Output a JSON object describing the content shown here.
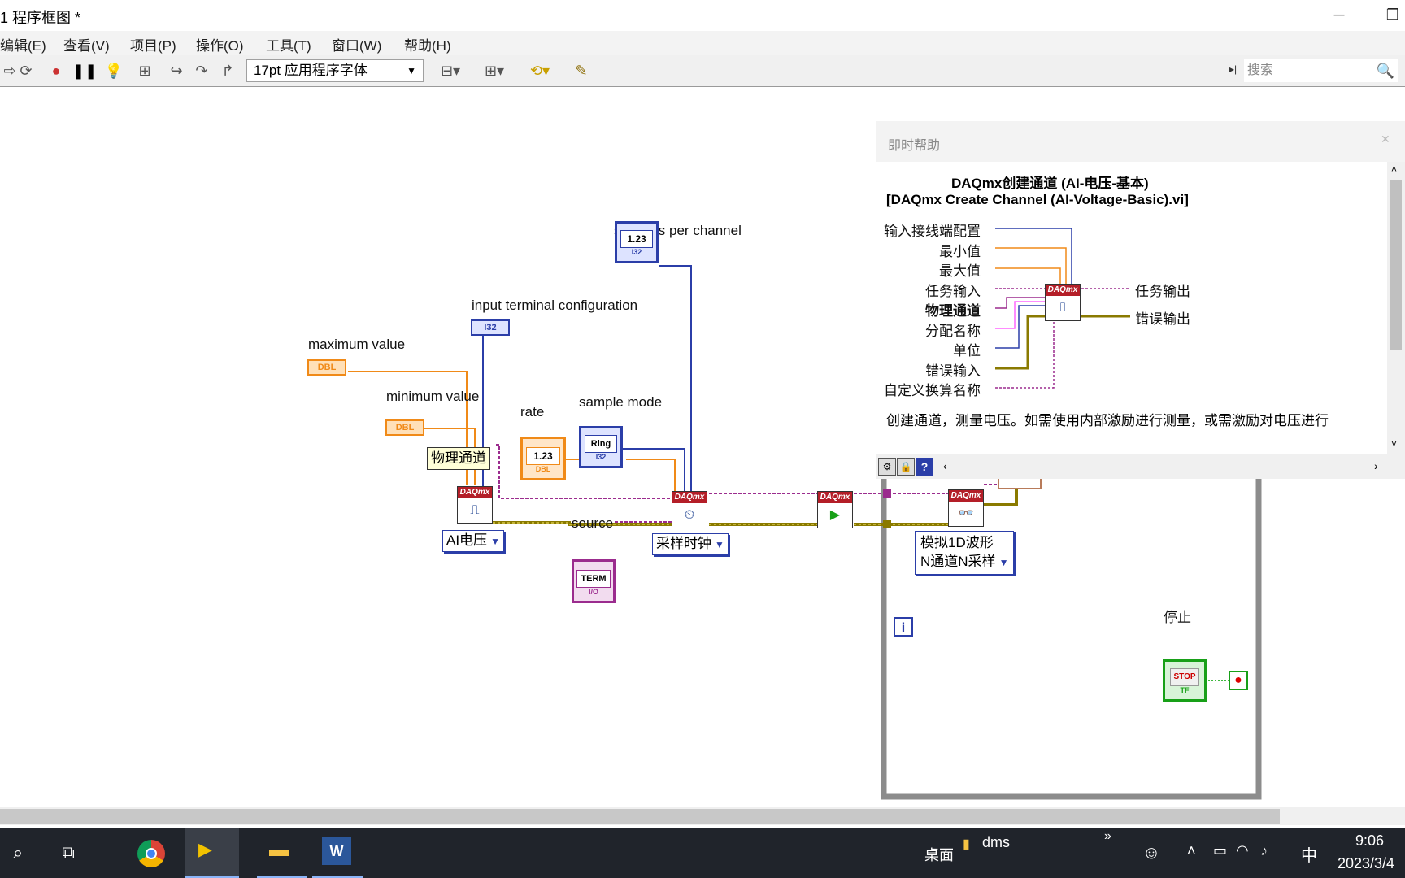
{
  "window": {
    "title": "1 程序框图 *",
    "minimize": "─",
    "restore": "❐"
  },
  "menu": [
    "编辑(E)",
    "查看(V)",
    "项目(P)",
    "操作(O)",
    "工具(T)",
    "窗口(W)",
    "帮助(H)"
  ],
  "toolbar": {
    "font": "17pt 应用程序字体",
    "search_placeholder": "搜索"
  },
  "diagram": {
    "labels": {
      "samples_per_channel": "samples per channel",
      "input_terminal_configuration": "input terminal configuration",
      "maximum_value": "maximum value",
      "minimum_value": "minimum value",
      "rate": "rate",
      "sample_mode": "sample mode",
      "source": "source",
      "stop": "停止"
    },
    "terminals": {
      "dbl": "DBL",
      "i32": "I32",
      "num": "1.23",
      "ring": "Ring",
      "term": "TERM",
      "io": "I/O",
      "stop_btn": "STOP",
      "tf": "TF",
      "loop_index": "i",
      "daqmx": "DAQmx"
    },
    "constant_physical_channel": "物理通道",
    "rings": {
      "ai_voltage": "AI电压",
      "sample_clock": "采样时钟",
      "read_line1": "模拟1D波形",
      "read_line2": "N通道N采样"
    }
  },
  "help": {
    "title": "即时帮助",
    "heading": "DAQmx创建通道 (AI-电压-基本)",
    "subheading": "[DAQmx Create Channel (AI-Voltage-Basic).vi]",
    "inputs": [
      "输入接线端配置",
      "最小值",
      "最大值",
      "任务输入",
      "物理通道",
      "分配名称",
      "单位",
      "错误输入",
      "自定义换算名称"
    ],
    "outputs": [
      "任务输出",
      "错误输出"
    ],
    "description": "创建通道，测量电压。如需使用内部激励进行测量，或需激励对电压进行"
  },
  "taskbar": {
    "desktop": "桌面",
    "folder": "dms",
    "more": "»",
    "ime": "中",
    "time": "9:06",
    "date": "2023/3/4"
  },
  "colors": {
    "orange_dbl": "#f08a18",
    "blue_i32": "#2b3ea8",
    "purple_task": "#9b2c8e",
    "error_wire": "#8a7a00",
    "daqmx_red": "#b41e28",
    "loop_border": "#7b7b7b",
    "taskbar_bg": "#20242b"
  }
}
